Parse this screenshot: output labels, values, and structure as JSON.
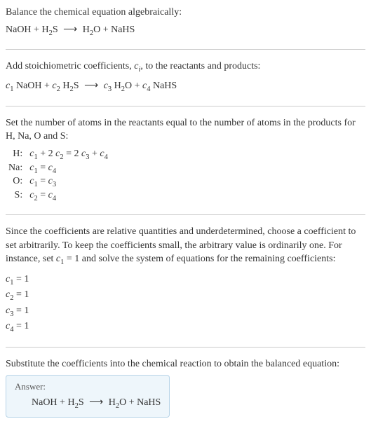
{
  "section1": {
    "intro": "Balance the chemical equation algebraically:",
    "eq_lhs1": "NaOH",
    "eq_lhs2": "H",
    "eq_lhs2_sub": "2",
    "eq_lhs2_tail": "S",
    "eq_rhs1": "H",
    "eq_rhs1_sub": "2",
    "eq_rhs1_tail": "O",
    "eq_rhs2": "NaHS",
    "arrow": "⟶"
  },
  "section2": {
    "intro_a": "Add stoichiometric coefficients, ",
    "intro_ci": "c",
    "intro_ci_sub": "i",
    "intro_b": ", to the reactants and products:",
    "c1": "c",
    "c1_sub": "1",
    "r1": " NaOH",
    "c2": "c",
    "c2_sub": "2",
    "r2a": " H",
    "r2sub": "2",
    "r2b": "S",
    "c3": "c",
    "c3_sub": "3",
    "p1a": " H",
    "p1sub": "2",
    "p1b": "O",
    "c4": "c",
    "c4_sub": "4",
    "p2": " NaHS",
    "arrow": "⟶"
  },
  "section3": {
    "intro": "Set the number of atoms in the reactants equal to the number of atoms in the products for H, Na, O and S:",
    "rows": {
      "h_label": "H:",
      "h_eq_a": "c",
      "h_eq_a_sub": "1",
      "h_eq_b": " + 2 ",
      "h_eq_c": "c",
      "h_eq_c_sub": "2",
      "h_eq_d": " = 2 ",
      "h_eq_e": "c",
      "h_eq_e_sub": "3",
      "h_eq_f": " + ",
      "h_eq_g": "c",
      "h_eq_g_sub": "4",
      "na_label": "Na:",
      "na_a": "c",
      "na_a_sub": "1",
      "na_eq": " = ",
      "na_b": "c",
      "na_b_sub": "4",
      "o_label": "O:",
      "o_a": "c",
      "o_a_sub": "1",
      "o_eq": " = ",
      "o_b": "c",
      "o_b_sub": "3",
      "s_label": "S:",
      "s_a": "c",
      "s_a_sub": "2",
      "s_eq": " = ",
      "s_b": "c",
      "s_b_sub": "4"
    }
  },
  "section4": {
    "intro_a": "Since the coefficients are relative quantities and underdetermined, choose a coefficient to set arbitrarily. To keep the coefficients small, the arbitrary value is ordinarily one. For instance, set ",
    "intro_c": "c",
    "intro_c_sub": "1",
    "intro_b": " = 1 and solve the system of equations for the remaining coefficients:",
    "lines": {
      "l1a": "c",
      "l1sub": "1",
      "l1b": " = 1",
      "l2a": "c",
      "l2sub": "2",
      "l2b": " = 1",
      "l3a": "c",
      "l3sub": "3",
      "l3b": " = 1",
      "l4a": "c",
      "l4sub": "4",
      "l4b": " = 1"
    }
  },
  "section5": {
    "intro": "Substitute the coefficients into the chemical reaction to obtain the balanced equation:",
    "answer_label": "Answer:",
    "eq_lhs1": "NaOH",
    "eq_lhs2": "H",
    "eq_lhs2_sub": "2",
    "eq_lhs2_tail": "S",
    "arrow": "⟶",
    "eq_rhs1": "H",
    "eq_rhs1_sub": "2",
    "eq_rhs1_tail": "O",
    "eq_rhs2": "NaHS"
  },
  "plus": " + "
}
